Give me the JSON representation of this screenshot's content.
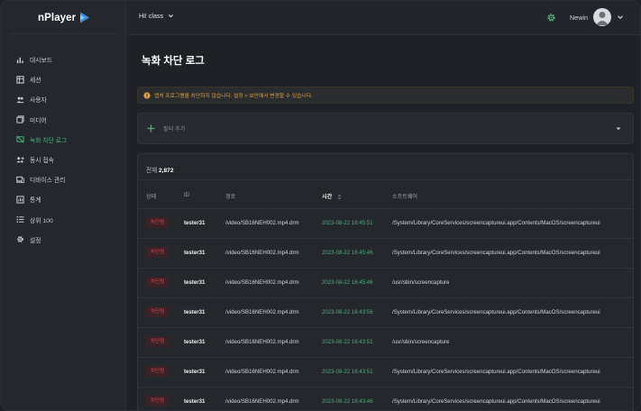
{
  "app": {
    "logo_text": "nPlayer"
  },
  "topbar": {
    "class_label": "Hi! class",
    "user_name": "Newin"
  },
  "sidebar": {
    "items": [
      {
        "label": "대시보드",
        "icon": "bar-chart-icon"
      },
      {
        "label": "세션",
        "icon": "table-icon"
      },
      {
        "label": "사용자",
        "icon": "users-icon"
      },
      {
        "label": "미디어",
        "icon": "media-icon"
      },
      {
        "label": "녹화 차단 로그",
        "icon": "blocked-record-icon",
        "active": true
      },
      {
        "label": "동시 접속",
        "icon": "concurrent-icon"
      },
      {
        "label": "디바이스 관리",
        "icon": "devices-icon"
      },
      {
        "label": "통계",
        "icon": "stats-icon"
      },
      {
        "label": "상위 100",
        "icon": "list-icon"
      },
      {
        "label": "설정",
        "icon": "gear-icon"
      }
    ]
  },
  "main": {
    "title": "녹화 차단 로그",
    "notice": "캡처 프로그램을 차단하지 않습니다. 설정 > 보안에서 변경할 수 있습니다.",
    "filter_label": "필터 추가",
    "total_label": "전체",
    "total_count": "2,872",
    "columns": {
      "status": "상태",
      "id": "ID",
      "path": "경로",
      "time": "시간",
      "software": "소프트웨어"
    },
    "rows": [
      {
        "status": "차단됨",
        "id": "tester31",
        "path": "/video/SB16NEH002.mp4.drm",
        "time": "2023-08-22 16:45:51",
        "software": "/System/Library/CoreServices/screencaptureui.app/Contents/MacOS/screencaptureui"
      },
      {
        "status": "차단됨",
        "id": "tester31",
        "path": "/video/SB16NEH002.mp4.drm",
        "time": "2023-08-22 16:45:46",
        "software": "/System/Library/CoreServices/screencaptureui.app/Contents/MacOS/screencaptureui"
      },
      {
        "status": "차단됨",
        "id": "tester31",
        "path": "/video/SB16NEH002.mp4.drm",
        "time": "2023-08-22 16:45:46",
        "software": "/usr/sbin/screencapture"
      },
      {
        "status": "차단됨",
        "id": "tester31",
        "path": "/video/SB16NEH002.mp4.drm",
        "time": "2023-08-22 16:43:56",
        "software": "/System/Library/CoreServices/screencaptureui.app/Contents/MacOS/screencaptureui"
      },
      {
        "status": "차단됨",
        "id": "tester31",
        "path": "/video/SB16NEH002.mp4.drm",
        "time": "2023-08-22 16:43:51",
        "software": "/usr/sbin/screencapture"
      },
      {
        "status": "차단됨",
        "id": "tester31",
        "path": "/video/SB16NEH002.mp4.drm",
        "time": "2023-08-22 16:43:51",
        "software": "/System/Library/CoreServices/screencaptureui.app/Contents/MacOS/screencaptureui"
      },
      {
        "status": "차단됨",
        "id": "tester31",
        "path": "/video/SB16NEH002.mp4.drm",
        "time": "2023-08-22 16:43:46",
        "software": "/System/Library/CoreServices/screencaptureui.app/Contents/MacOS/screencaptureui"
      }
    ]
  },
  "colors": {
    "accent": "#4caf7a",
    "danger": "#d8474f",
    "warning": "#e2a23f",
    "background": "#1e2126"
  }
}
